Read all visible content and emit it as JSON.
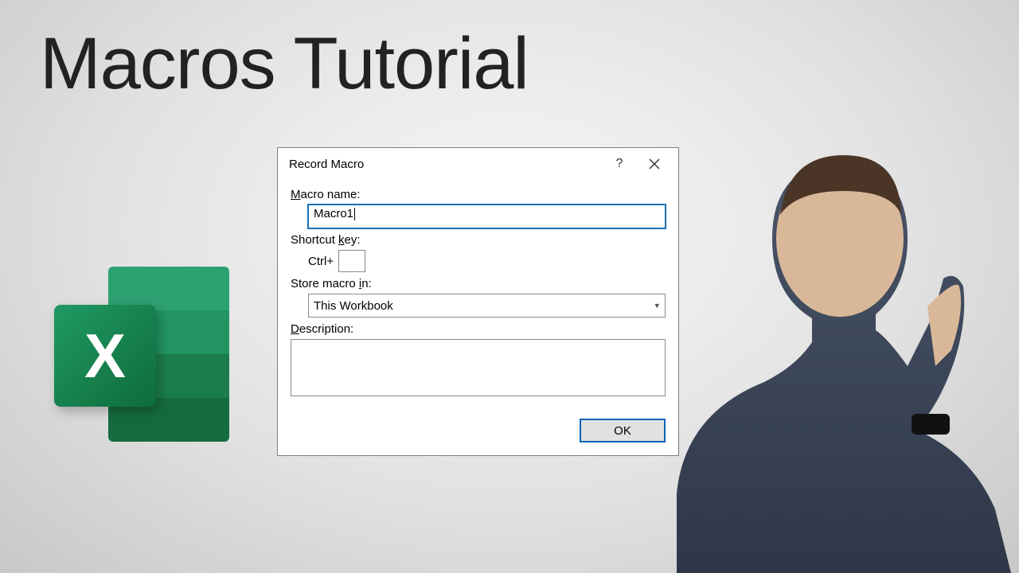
{
  "title": "Macros Tutorial",
  "logo": {
    "letter": "X"
  },
  "dialog": {
    "title": "Record Macro",
    "help_symbol": "?",
    "labels": {
      "macro_name": "acro name:",
      "macro_name_prefix": "M",
      "shortcut_key": "ey:",
      "shortcut_key_prefix": "Shortcut ",
      "shortcut_key_ul": "k",
      "ctrl_plus": "Ctrl+",
      "store_in": "n:",
      "store_in_prefix": "Store macro ",
      "store_in_ul": "i",
      "description": "escription:",
      "description_prefix": "D"
    },
    "fields": {
      "macro_name_value": "Macro1",
      "shortcut_key_value": "",
      "store_in_value": "This Workbook",
      "description_value": ""
    },
    "buttons": {
      "ok": "OK"
    }
  }
}
